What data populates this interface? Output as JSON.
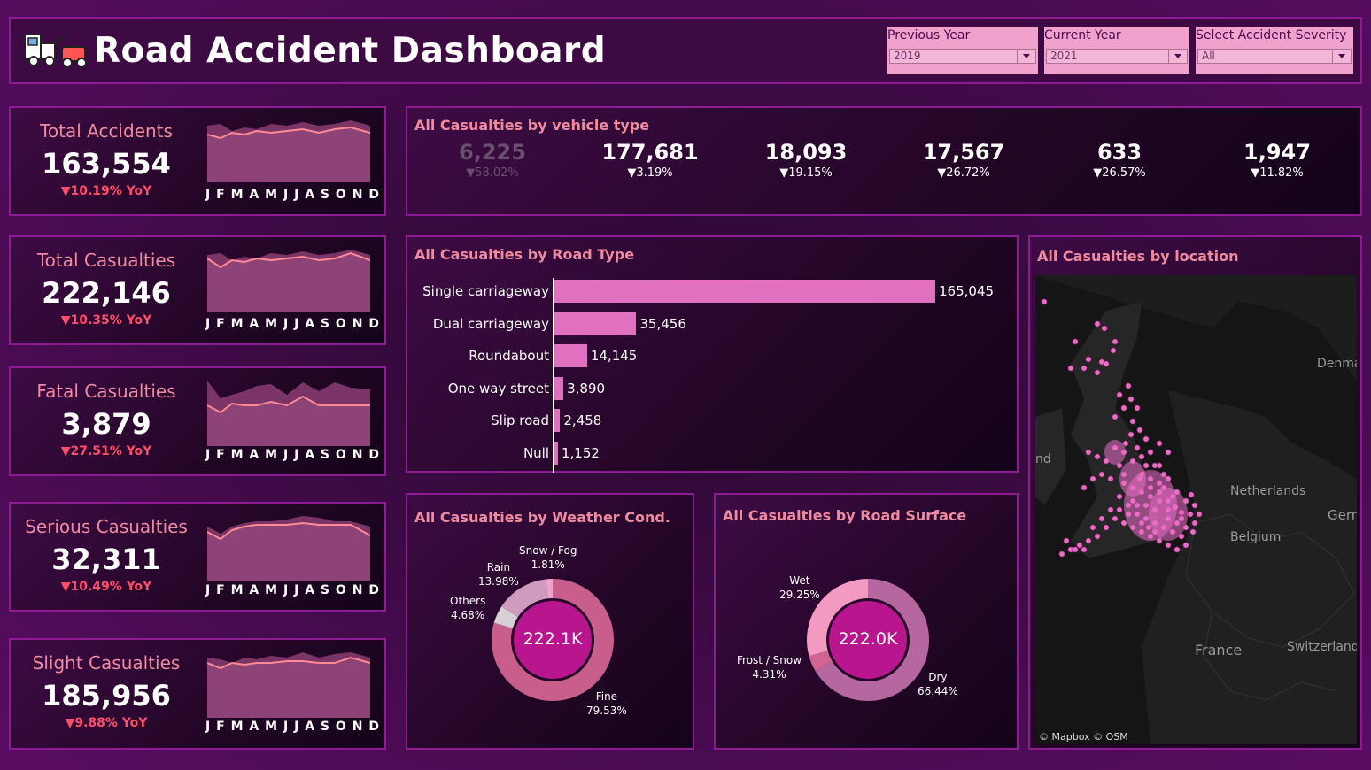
{
  "header": {
    "title": "Road Accident Dashboard",
    "filters": [
      {
        "label": "Previous Year",
        "value": "2019"
      },
      {
        "label": "Current Year",
        "value": "2021"
      },
      {
        "label": "Select Accident Severity",
        "value": "All"
      }
    ]
  },
  "kpis": [
    {
      "label": "Total Accidents",
      "value": "163,554",
      "yoy": "▼10.19% YoY"
    },
    {
      "label": "Total Casualties",
      "value": "222,146",
      "yoy": "▼10.35% YoY"
    },
    {
      "label": "Fatal Casualties",
      "value": "3,879",
      "yoy": "▼27.51% YoY"
    },
    {
      "label": "Serious Casualties",
      "value": "32,311",
      "yoy": "▼10.49% YoY"
    },
    {
      "label": "Slight Casualties",
      "value": "185,956",
      "yoy": "▼9.88% YoY"
    }
  ],
  "months": [
    "J",
    "F",
    "M",
    "A",
    "M",
    "J",
    "J",
    "A",
    "S",
    "O",
    "N",
    "D"
  ],
  "vehicle": {
    "title": "All Casualties by vehicle type",
    "items": [
      {
        "value": "6,225",
        "pct": "▼58.02%"
      },
      {
        "value": "177,681",
        "pct": "▼3.19%"
      },
      {
        "value": "18,093",
        "pct": "▼19.15%"
      },
      {
        "value": "17,567",
        "pct": "▼26.72%"
      },
      {
        "value": "633",
        "pct": "▼26.57%"
      },
      {
        "value": "1,947",
        "pct": "▼11.82%"
      }
    ]
  },
  "road_type": {
    "title": "All Casualties by Road Type"
  },
  "weather": {
    "title": "All Casualties by Weather Cond.",
    "center": "222.1K",
    "labels": [
      {
        "name": "Snow / Fog",
        "pct": "1.81%"
      },
      {
        "name": "Rain",
        "pct": "13.98%"
      },
      {
        "name": "Others",
        "pct": "4.68%"
      },
      {
        "name": "Fine",
        "pct": "79.53%"
      }
    ]
  },
  "surface": {
    "title": "All Casualties by Road Surface",
    "center": "222.0K",
    "labels": [
      {
        "name": "Wet",
        "pct": "29.25%"
      },
      {
        "name": "Frost / Snow",
        "pct": "4.31%"
      },
      {
        "name": "Dry",
        "pct": "66.44%"
      }
    ]
  },
  "map": {
    "title": "All Casualties by location",
    "labels": [
      "Denmar",
      "Netherlands",
      "Germ",
      "Belgium",
      "France",
      "Switzerland",
      "nd"
    ],
    "attribution": "© Mapbox © OSM"
  },
  "colors": {
    "accent": "#f08aa0",
    "bar": "#e070c0",
    "border": "#8e1b93",
    "down": "#ff4d6a"
  },
  "chart_data": [
    {
      "type": "bar",
      "title": "All Casualties by Road Type",
      "orientation": "horizontal",
      "categories": [
        "Single carriageway",
        "Dual carriageway",
        "Roundabout",
        "One way street",
        "Slip road",
        "Null"
      ],
      "values": [
        165045,
        35456,
        14145,
        3890,
        2458,
        1152
      ],
      "value_labels": [
        "165,045",
        "35,456",
        "14,145",
        "3,890",
        "2,458",
        "1,152"
      ]
    },
    {
      "type": "pie",
      "title": "All Casualties by Weather Cond.",
      "categories": [
        "Fine",
        "Others",
        "Rain",
        "Snow / Fog"
      ],
      "values": [
        79.53,
        4.68,
        13.98,
        1.81
      ]
    },
    {
      "type": "pie",
      "title": "All Casualties by Road Surface",
      "categories": [
        "Dry",
        "Frost / Snow",
        "Wet"
      ],
      "values": [
        66.44,
        4.31,
        29.25
      ]
    }
  ]
}
